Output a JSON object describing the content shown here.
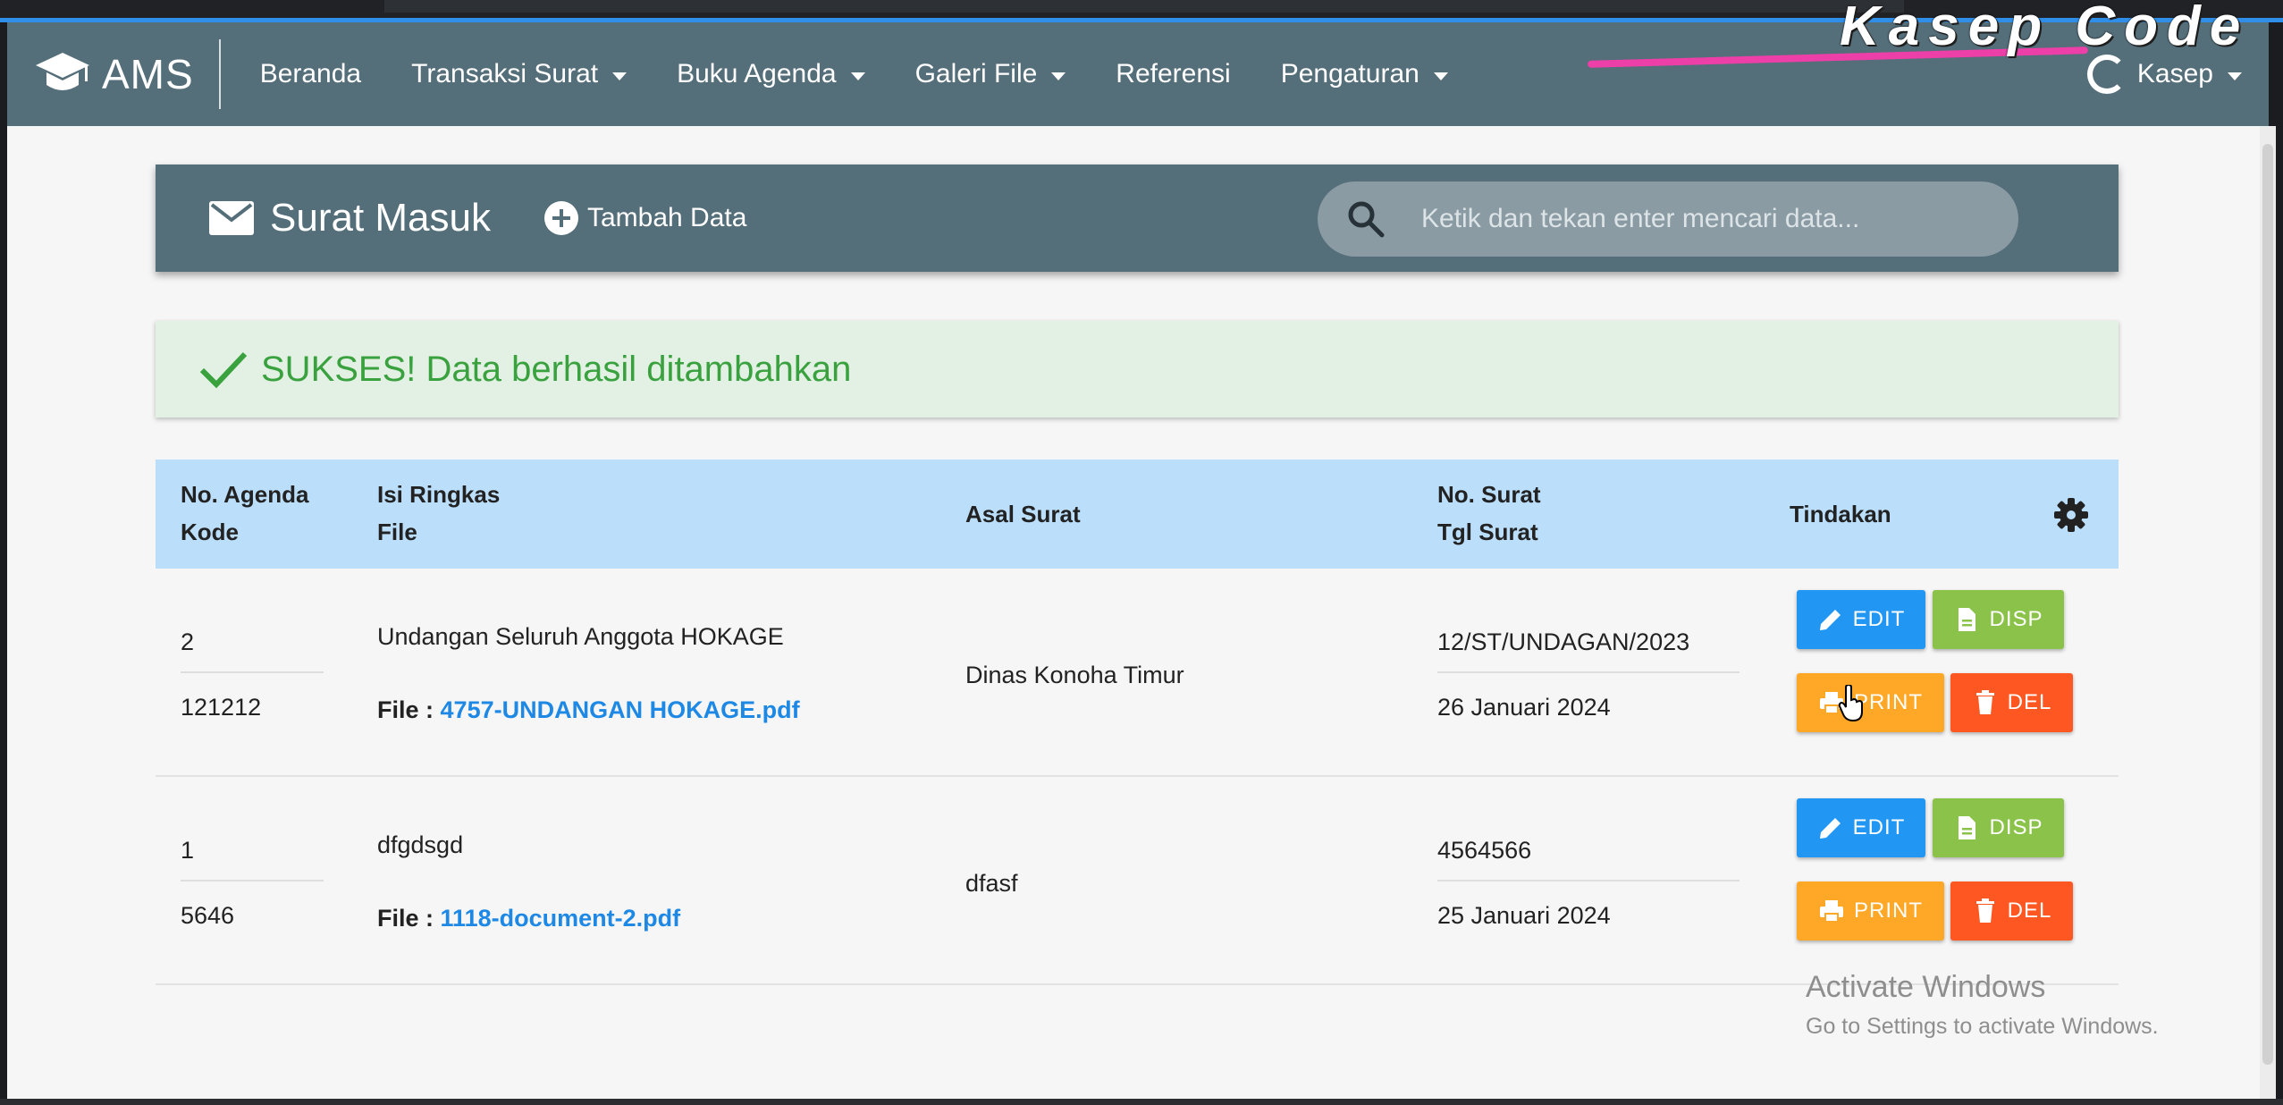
{
  "watermark": "Kasep Code",
  "navbar": {
    "brand": "AMS",
    "items": [
      {
        "label": "Beranda",
        "dropdown": false
      },
      {
        "label": "Transaksi Surat",
        "dropdown": true
      },
      {
        "label": "Buku Agenda",
        "dropdown": true
      },
      {
        "label": "Galeri File",
        "dropdown": true
      },
      {
        "label": "Referensi",
        "dropdown": false
      },
      {
        "label": "Pengaturan",
        "dropdown": true
      }
    ],
    "user": "Kasep"
  },
  "header": {
    "title": "Surat Masuk",
    "add_label": "Tambah Data",
    "search_placeholder": "Ketik dan tekan enter mencari data..."
  },
  "alert": {
    "message": "SUKSES! Data berhasil ditambahkan"
  },
  "table": {
    "headers": {
      "col1_line1": "No. Agenda",
      "col1_line2": "Kode",
      "col2_line1": "Isi Ringkas",
      "col2_line2": "File",
      "col3": "Asal Surat",
      "col4_line1": "No. Surat",
      "col4_line2": "Tgl Surat",
      "col5": "Tindakan"
    },
    "file_prefix": "File :",
    "rows": [
      {
        "no_agenda": "2",
        "kode": "121212",
        "isi_ringkas": "Undangan Seluruh Anggota HOKAGE",
        "file": "4757-UNDANGAN HOKAGE.pdf",
        "asal_surat": "Dinas Konoha Timur",
        "no_surat": "12/ST/UNDAGAN/2023",
        "tgl_surat": "26 Januari 2024"
      },
      {
        "no_agenda": "1",
        "kode": "5646",
        "isi_ringkas": "dfgdsgd",
        "file": "1118-document-2.pdf",
        "asal_surat": "dfasf",
        "no_surat": "4564566",
        "tgl_surat": "25 Januari 2024"
      }
    ],
    "actions": {
      "edit": "EDIT",
      "disp": "DISP",
      "print": "PRINT",
      "del": "DEL"
    }
  },
  "activate_windows": {
    "title": "Activate Windows",
    "subtitle": "Go to Settings to activate Windows."
  },
  "colors": {
    "navbar": "#546e7a",
    "table_header": "#bbdefb",
    "edit": "#2196f3",
    "disp": "#8bc34a",
    "print": "#ffa726",
    "del": "#ff5722",
    "success_text": "#3aa13f",
    "success_bg": "#e3f1e4",
    "link": "#1e88e5"
  }
}
